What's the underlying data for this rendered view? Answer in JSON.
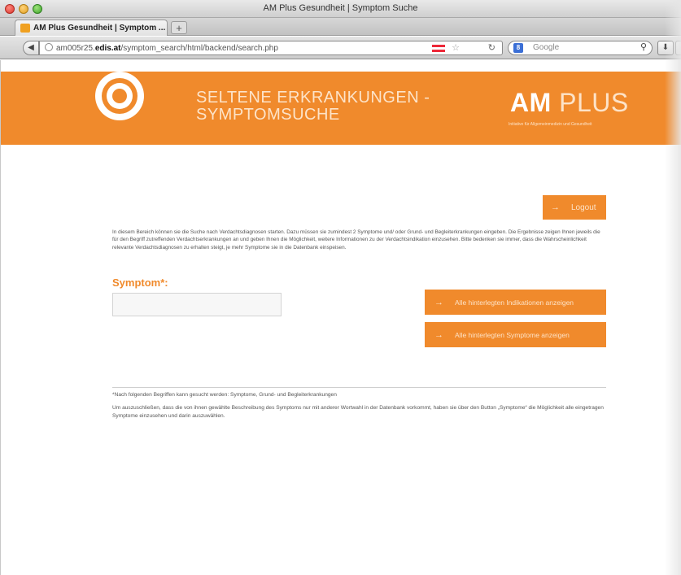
{
  "browser": {
    "window_title": "AM Plus Gesundheit | Symptom Suche",
    "tab_label": "AM Plus Gesundheit | Symptom ...",
    "new_tab_label": "+",
    "url_prefix": "am005r25.",
    "url_domain": "edis.at",
    "url_path": "/symptom_search/html/backend/search.php",
    "search_placeholder": "Google",
    "icons": {
      "back": "back-arrow-icon",
      "favicon": "favicon-icon",
      "globe": "globe-icon",
      "flag": "austria-flag-icon",
      "star": "bookmark-star-icon",
      "reload": "reload-icon",
      "search_engine": "google-engine-icon",
      "search": "magnifier-icon",
      "download": "download-icon"
    }
  },
  "header": {
    "title_line1": "SELTENE ERKRANKUNGEN -",
    "title_line2": "SYMPTOMSUCHE",
    "brand_am": "AM",
    "brand_plus": " PLUS",
    "tagline": "Initiative für Allgemeinmedizin und Gesundheit"
  },
  "logout": {
    "label": "Logout"
  },
  "intro": {
    "text": "In diesem Bereich können sie die Suche nach Verdachtsdiagnosen starten. Dazu müssen sie zumindest 2 Symptome und/ oder Grund- und Begleiterkrankungen eingeben. Die Ergebnisse zeigen Ihnen jeweils die für den Begriff zutreffenden Verdachtserkrankungen an und geben Ihnen die Möglichkeit, weitere Informationen zu der Verdachtsindikation einzusehen. Bitte bedenken sie immer, dass die Wahrscheinlichkeit relevante Verdachtsdiagnosen zu erhalten steigt, je mehr Symptome sie in die Datenbank einspeisen."
  },
  "search": {
    "label": "Symptom*:",
    "value": "",
    "button_indikationen": "Alle hinterlegten Indikationen anzeigen",
    "button_symptome": "Alle hinterlegten Symptome anzeigen"
  },
  "notes": {
    "line1": "*Nach folgenden Begriffen kann gesucht werden: Symptome, Grund- und Begleiterkrankungen",
    "line2": "Um auszuschließen, dass die von ihnen gewählte Beschreibung des Symptoms nur mit anderer Wortwahl in der Datenbank vorkommt, haben sie über den Button „Symptome“ die Möglichkeit alle eingetragen Symptome einzusehen und darin auszuwählen."
  },
  "colors": {
    "accent": "#f08a2c",
    "accent_text": "#fde3c8",
    "body_text": "#555555"
  }
}
